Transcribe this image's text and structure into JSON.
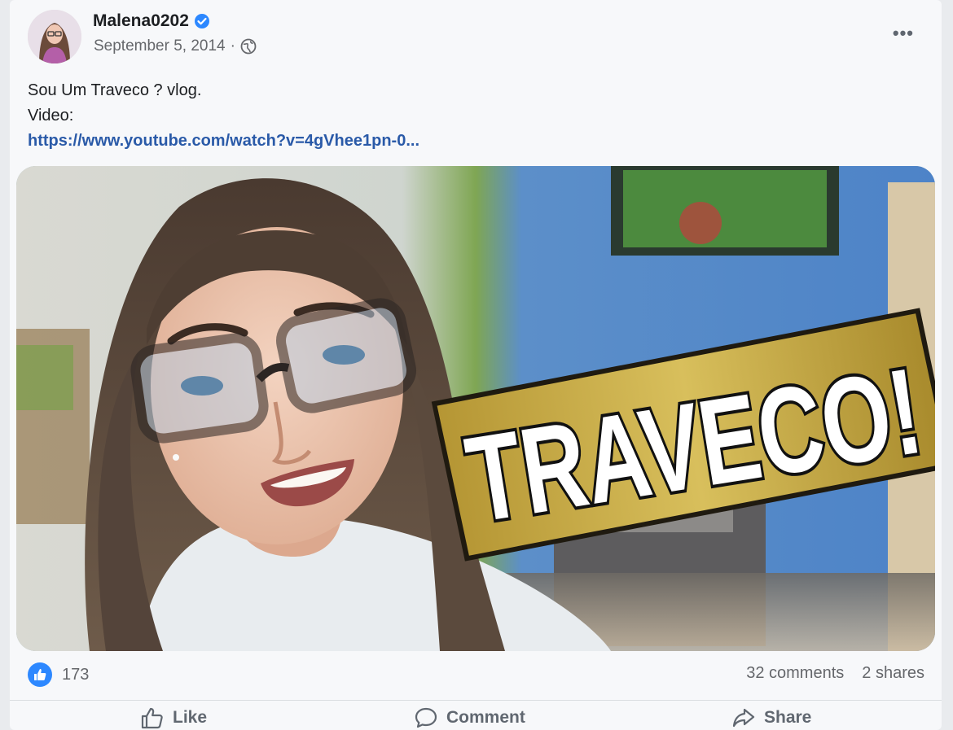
{
  "post": {
    "author": "Malena0202",
    "date": "September 5, 2014",
    "meta_sep": "·",
    "text_line1": "Sou Um Traveco ? vlog.",
    "text_line2": "Video:",
    "link": "https://www.youtube.com/watch?v=4gVhee1pn-0...",
    "more_label": "•••"
  },
  "thumbnail": {
    "overlay_text": "TRAVECO!"
  },
  "stats": {
    "likes": "173",
    "comments": "32 comments",
    "shares": "2 shares"
  },
  "actions": {
    "like": "Like",
    "comment": "Comment",
    "share": "Share"
  },
  "colors": {
    "accent": "#2d88ff",
    "link": "#2a5aa8",
    "banner": "#c9a83a"
  },
  "icons": [
    "verified-badge-icon",
    "globe-icon",
    "more-options-icon",
    "like-reaction-icon",
    "thumbs-up-icon",
    "comment-icon",
    "share-icon"
  ]
}
